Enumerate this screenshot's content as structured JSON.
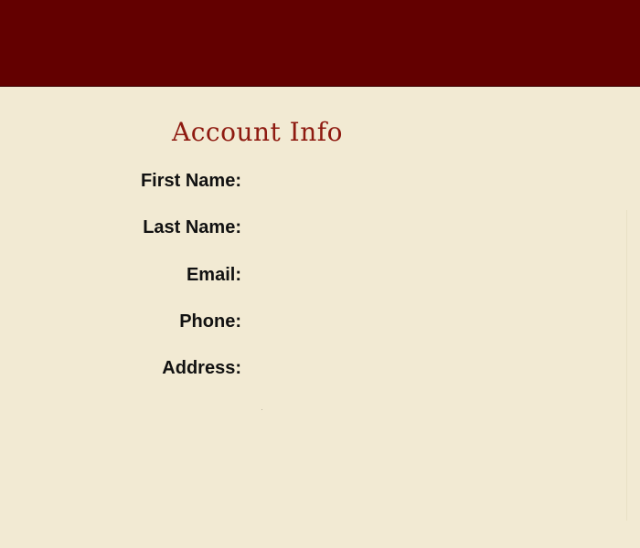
{
  "form": {
    "title": "Account Info",
    "fields": [
      {
        "label": "First Name:",
        "value": ""
      },
      {
        "label": "Last Name:",
        "value": ""
      },
      {
        "label": "Email:",
        "value": ""
      },
      {
        "label": "Phone:",
        "value": ""
      },
      {
        "label": "Address:",
        "value": ""
      }
    ]
  },
  "colors": {
    "banner": "#630000",
    "background": "#f2ead3",
    "title": "#8e1a10",
    "label": "#111111"
  }
}
